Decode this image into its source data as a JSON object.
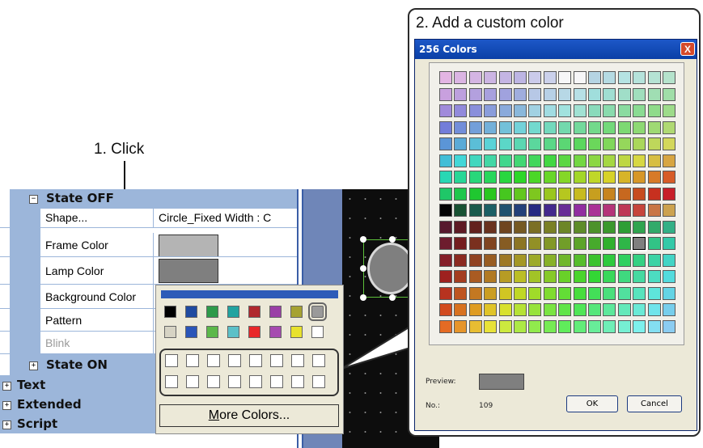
{
  "annotations": {
    "step1": "1. Click",
    "step2": "2. Add a custom color"
  },
  "property_grid": {
    "state_off_header": "State OFF",
    "rows": [
      {
        "name": "Shape...",
        "value": "Circle_Fixed Width : C"
      },
      {
        "name": "Frame Color",
        "value": ""
      },
      {
        "name": "Lamp Color",
        "value": ""
      },
      {
        "name": "Background Color",
        "value": ""
      },
      {
        "name": "Pattern",
        "value": ""
      },
      {
        "name": "Blink",
        "value": ""
      }
    ],
    "state_on_header": "State ON",
    "sections": [
      "Text",
      "Extended",
      "Script"
    ],
    "frame_color": "#b4b4b4",
    "lamp_color": "#7f7f7f"
  },
  "color_dropdown": {
    "row1": [
      "#000000",
      "#1f4aa0",
      "#2e9a4a",
      "#22a3a0",
      "#b0282e",
      "#9a3fa6",
      "#a6a232",
      "#9a9a9a"
    ],
    "row2": [
      "#d6d3c4",
      "#2a55b8",
      "#5cb84a",
      "#5cc0c8",
      "#e8282a",
      "#a64ab0",
      "#e8e22e",
      "#ffffff"
    ],
    "selected_index_row1": 7,
    "custom_slots": 16,
    "more_colors_label": "More Colors..."
  },
  "dialog": {
    "title": "256 Colors",
    "close_label": "X",
    "preview_label": "Preview:",
    "number_label": "No.:",
    "number_value": "109",
    "ok_label": "OK",
    "cancel_label": "Cancel",
    "preview_color": "#7f7f7f",
    "selected_cell": {
      "row": 10,
      "col": 13
    }
  }
}
